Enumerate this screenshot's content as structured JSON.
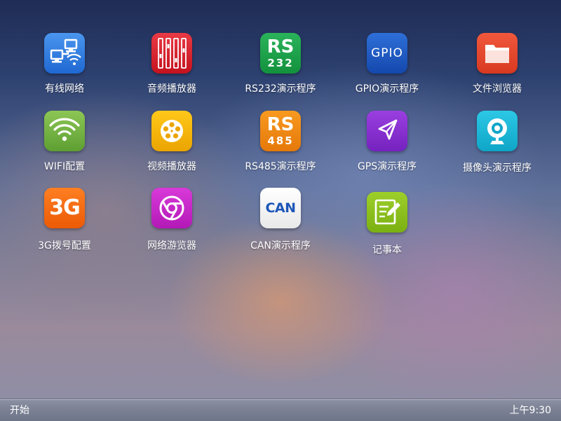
{
  "apps": [
    {
      "label": "有线网络",
      "icon": "wired-network-icon",
      "color": "#2f7de1"
    },
    {
      "label": "音频播放器",
      "icon": "audio-player-icon",
      "color": "#d6202c"
    },
    {
      "label": "RS232演示程序",
      "icon": "rs232-icon",
      "color": "#1ea24b",
      "icon_text_top": "RS",
      "icon_text_bottom": "232"
    },
    {
      "label": "GPIO演示程序",
      "icon": "gpio-icon",
      "color": "#1f5ec8",
      "icon_text_top": "GPIO"
    },
    {
      "label": "文件浏览器",
      "icon": "folder-icon",
      "color": "#e8472d"
    },
    {
      "label": "WIFI配置",
      "icon": "wifi-icon",
      "color": "#78b644"
    },
    {
      "label": "视频播放器",
      "icon": "video-player-icon",
      "color": "#f5b800"
    },
    {
      "label": "RS485演示程序",
      "icon": "rs485-icon",
      "color": "#f08a10",
      "icon_text_top": "RS",
      "icon_text_bottom": "485"
    },
    {
      "label": "GPS演示程序",
      "icon": "gps-icon",
      "color": "#8a2fd0"
    },
    {
      "label": "摄像头演示程序",
      "icon": "camera-icon",
      "color": "#19b8d8"
    },
    {
      "label": "3G拨号配置",
      "icon": "3g-dial-icon",
      "color": "#f26a0e",
      "icon_text_top": "3G"
    },
    {
      "label": "网络游览器",
      "icon": "browser-icon",
      "color": "#c023c9"
    },
    {
      "label": "CAN演示程序",
      "icon": "can-icon",
      "color": "#f4f4f4",
      "icon_text_top": "CAN"
    },
    {
      "label": "记事本",
      "icon": "notepad-icon",
      "color": "#8fc21f"
    }
  ],
  "taskbar": {
    "start_label": "开始",
    "clock": "上午9:30"
  }
}
